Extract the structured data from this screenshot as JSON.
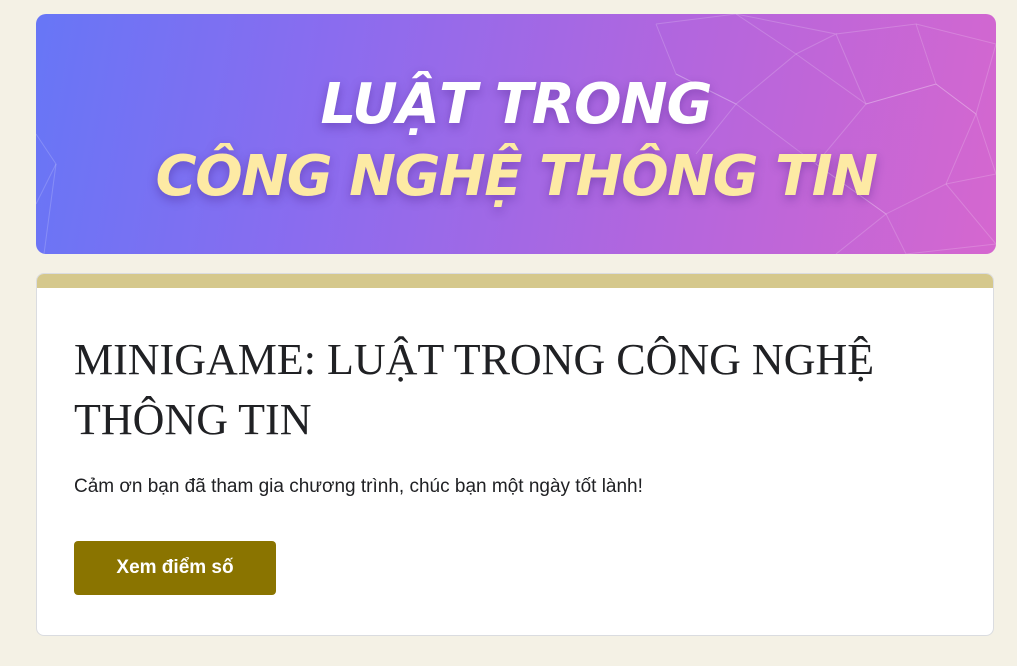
{
  "banner": {
    "line1": "LUẬT TRONG",
    "line2": "CÔNG NGHỆ THÔNG TIN"
  },
  "form": {
    "title": "MINIGAME: LUẬT TRONG CÔNG NGHỆ THÔNG TIN",
    "description": "Cảm ơn bạn đã tham gia chương trình, chúc bạn một ngày tốt lành!",
    "score_button_label": "Xem điểm số"
  },
  "colors": {
    "page_background": "#f4f1e5",
    "accent_bar": "#d5c88c",
    "button": "#8a7400",
    "banner_gradient_start": "#6776f6",
    "banner_gradient_end": "#d567cf",
    "banner_line2_text": "#fdeaa4"
  }
}
